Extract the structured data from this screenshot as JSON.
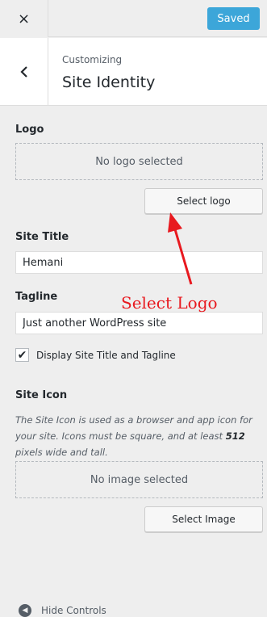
{
  "topbar": {
    "close_icon": "×",
    "saved_label": "Saved",
    "accent": "#33a3d8"
  },
  "header": {
    "back_icon": "‹",
    "breadcrumb": "Customizing",
    "title": "Site Identity"
  },
  "logo": {
    "label": "Logo",
    "placeholder": "No logo selected",
    "button": "Select logo"
  },
  "site_title": {
    "label": "Site Title",
    "value": "Hemani"
  },
  "tagline": {
    "label": "Tagline",
    "value": "Just another WordPress site"
  },
  "display_toggle": {
    "label": "Display Site Title and Tagline",
    "checked": true,
    "check_glyph": "✔"
  },
  "site_icon": {
    "label": "Site Icon",
    "desc_pre": "The Site Icon is used as a browser and app icon for your site. Icons must be square, and at least ",
    "desc_size": "512",
    "desc_post": " pixels wide and tall.",
    "placeholder": "No image selected",
    "button": "Select Image"
  },
  "annotation": {
    "text": "Select Logo",
    "color": "#e8191f"
  },
  "footer": {
    "label": "Hide Controls",
    "icon": "collapse-icon"
  }
}
